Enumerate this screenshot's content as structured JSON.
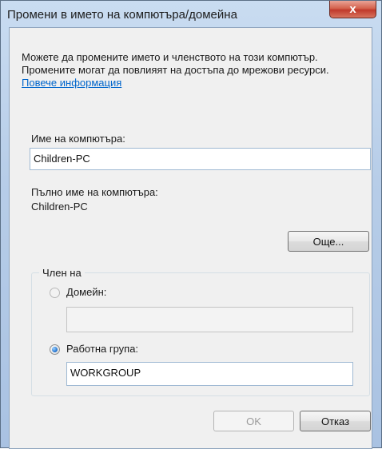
{
  "window": {
    "title": "Промени в името на компютъра/домейна",
    "close_label": "x"
  },
  "info": {
    "text": "Можете да промените името и членството на този компютър. Промените могат да повлияят на достъпа до мрежови ресурси.",
    "link": "Повече информация"
  },
  "computer_name": {
    "label": "Име на компютъра:",
    "value": "Children-PC"
  },
  "full_name": {
    "label": "Пълно име на компютъра:",
    "value": "Children-PC"
  },
  "more_button": "Още...",
  "member_of": {
    "legend": "Член на",
    "domain": {
      "label": "Домейн:",
      "value": "",
      "selected": false
    },
    "workgroup": {
      "label": "Работна група:",
      "value": "WORKGROUP",
      "selected": true
    }
  },
  "buttons": {
    "ok": "OK",
    "cancel": "Отказ"
  }
}
